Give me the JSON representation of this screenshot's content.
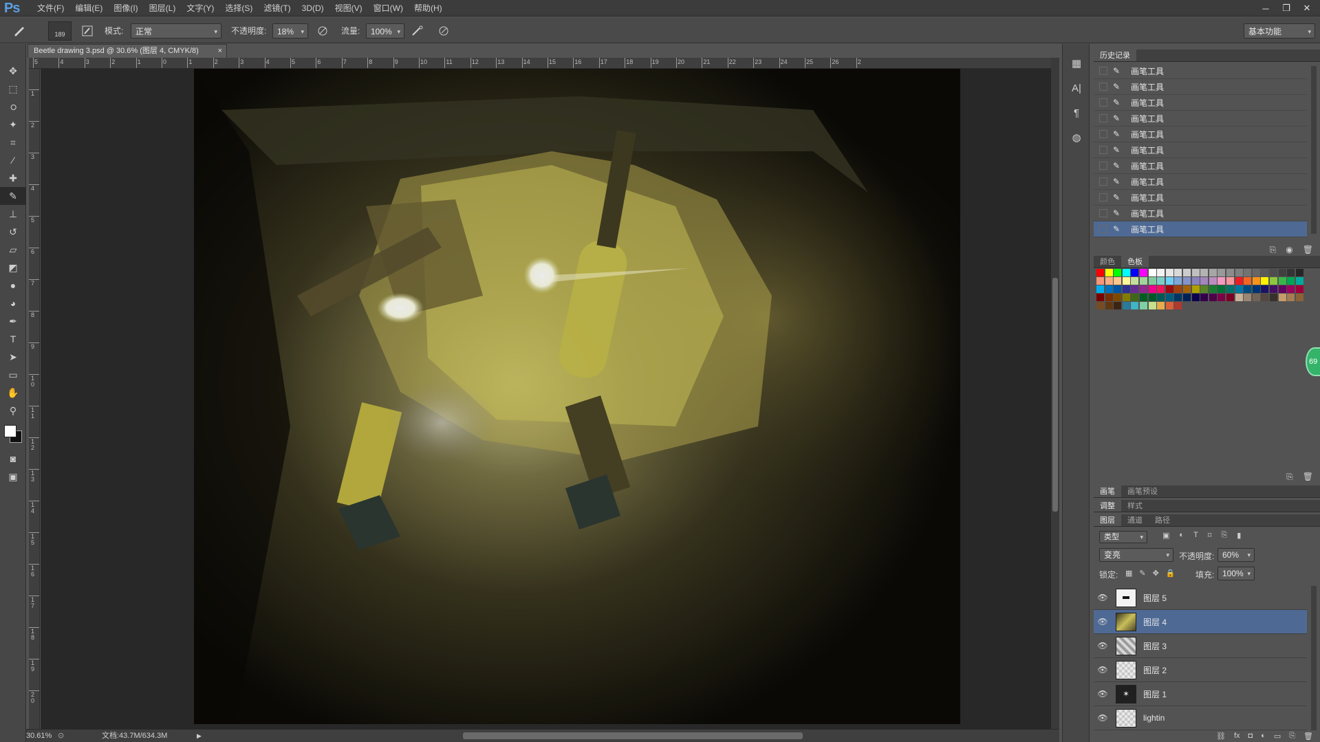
{
  "app": {
    "logo": "Ps"
  },
  "menu": [
    "文件(F)",
    "编辑(E)",
    "图像(I)",
    "图层(L)",
    "文字(Y)",
    "选择(S)",
    "滤镜(T)",
    "3D(D)",
    "视图(V)",
    "窗口(W)",
    "帮助(H)"
  ],
  "window_controls": {
    "minimize": "─",
    "restore": "❐",
    "close": "✕"
  },
  "options": {
    "brush_size": "189",
    "mode_label": "模式:",
    "mode_value": "正常",
    "opacity_label": "不透明度:",
    "opacity_value": "18%",
    "flow_label": "流量:",
    "flow_value": "100%",
    "workspace": "基本功能"
  },
  "document": {
    "tab_title": "Beetle drawing 3.psd @ 30.6% (图层 4, CMYK/8)",
    "tab_close": "×",
    "zoom": "30.61%",
    "doc_size": "文档:43.7M/634.3M"
  },
  "ruler": {
    "h_labels": [
      "5",
      "4",
      "3",
      "2",
      "1",
      "0",
      "1",
      "2",
      "3",
      "4",
      "5",
      "6",
      "7",
      "8",
      "9",
      "10",
      "11",
      "12",
      "13",
      "14",
      "15",
      "16",
      "17",
      "18",
      "19",
      "20",
      "21",
      "22",
      "23",
      "24",
      "25",
      "26",
      "2"
    ],
    "v_labels": [
      "1",
      "2",
      "3",
      "4",
      "5",
      "6",
      "7",
      "8",
      "9",
      "10",
      "11",
      "12",
      "13",
      "14",
      "15",
      "16",
      "17",
      "18",
      "19",
      "20"
    ]
  },
  "history": {
    "tabs": [
      "历史记录"
    ],
    "items": [
      "画笔工具",
      "画笔工具",
      "画笔工具",
      "画笔工具",
      "画笔工具",
      "画笔工具",
      "画笔工具",
      "画笔工具",
      "画笔工具",
      "画笔工具",
      "画笔工具"
    ],
    "selected_index": 10
  },
  "color_panel": {
    "tabs": [
      "颜色",
      "色板"
    ],
    "active": "色板"
  },
  "brush_panel": {
    "tabs": [
      "画笔",
      "画笔预设"
    ]
  },
  "adjust_panel": {
    "tabs": [
      "调整",
      "样式"
    ]
  },
  "layers_panel": {
    "tabs": [
      "图层",
      "通道",
      "路径"
    ],
    "filter": "类型",
    "blend_mode": "变亮",
    "opacity_label": "不透明度:",
    "opacity_value": "60%",
    "lock_label": "锁定:",
    "fill_label": "填充:",
    "fill_value": "100%",
    "layers": [
      "图层 5",
      "图层 4",
      "图层 3",
      "图层 2",
      "图层 1",
      "lightin"
    ],
    "selected_index": 1
  },
  "side_bubble": "69",
  "colors": {
    "accent": "#4e6a94",
    "ps_logo": "#5aa0e6",
    "bg": "#535353"
  }
}
